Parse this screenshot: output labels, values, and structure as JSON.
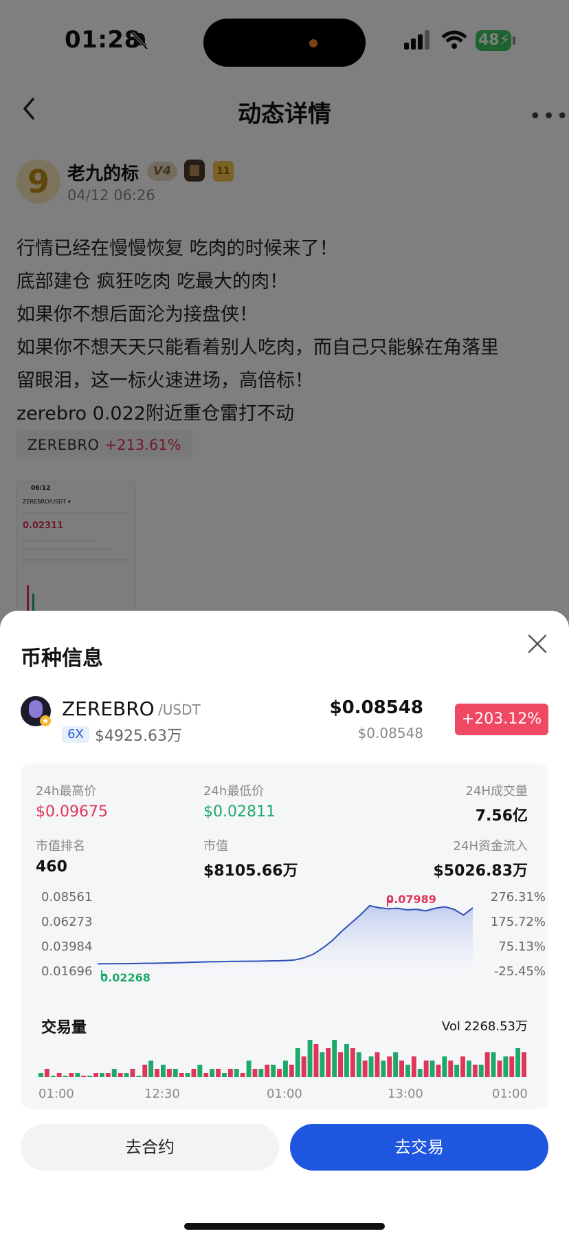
{
  "status_bar": {
    "time": "01:28",
    "battery": "48"
  },
  "nav": {
    "title": "动态详情"
  },
  "post": {
    "author": "老九的标",
    "author_avatar_text": "9",
    "badge_v": "V4",
    "badge_level": "11",
    "time": "04/12 06:26",
    "lines": [
      "行情已经在慢慢恢复 吃肉的时候来了！",
      "底部建仓 疯狂吃肉 吃最大的肉！",
      "如果你不想后面沦为接盘侠！",
      "如果你不想天天只能看着别人吃肉，而自己只能躲在角落里",
      "留眼泪，这一标火速进场，高倍标！",
      "zerebro 0.022附近重仓雷打不动"
    ],
    "tag": {
      "name": "ZEREBRO",
      "change": "+213.61%"
    },
    "thumbnail": {
      "time": "06/12",
      "pair": "ZEREBRO/USDT ▾",
      "price": "0.02311"
    }
  },
  "sheet": {
    "title": "币种信息",
    "coin": {
      "name": "ZEREBRO",
      "quote": "/USDT",
      "leverage": "6X",
      "market_cap": "$4925.63万",
      "price": "$0.08548",
      "price_sub": "$0.08548",
      "change": "+203.12%"
    },
    "stats": {
      "high_label": "24h最高价",
      "high_value": "$0.09675",
      "low_label": "24h最低价",
      "low_value": "$0.02811",
      "volume_label": "24H成交量",
      "volume_value": "7.56亿",
      "rank_label": "市值排名",
      "rank_value": "460",
      "mcap_label": "市值",
      "mcap_value": "$8105.66万",
      "inflow_label": "24H资金流入",
      "inflow_value": "$5026.83万"
    },
    "volume": {
      "title": "交易量",
      "total": "Vol 2268.53万"
    },
    "buttons": {
      "contract": "去合约",
      "trade": "去交易"
    }
  },
  "colors": {
    "up": "#e0355a",
    "down": "#1ea96a",
    "accent": "#1f56e0",
    "line": "#2b4fb8"
  },
  "chart_data": {
    "type": "line",
    "y_ticks_left": [
      "0.08561",
      "0.06273",
      "0.03984",
      "0.01696"
    ],
    "y_ticks_right": [
      "276.31%",
      "175.72%",
      "75.13%",
      "-25.45%"
    ],
    "x_ticks": [
      "01:00",
      "12:30",
      "01:00",
      "13:00",
      "01:00"
    ],
    "ylim": [
      0.01696,
      0.08561
    ],
    "high_marker": "0.07989",
    "low_marker": "0.02268",
    "price_series": [
      0.0227,
      0.0228,
      0.0229,
      0.0229,
      0.023,
      0.0232,
      0.0233,
      0.0234,
      0.0236,
      0.0239,
      0.0242,
      0.0245,
      0.0247,
      0.0248,
      0.025,
      0.0251,
      0.0252,
      0.0253,
      0.0254,
      0.0256,
      0.0259,
      0.0265,
      0.0285,
      0.032,
      0.038,
      0.045,
      0.054,
      0.062,
      0.07,
      0.079,
      0.077,
      0.076,
      0.0765,
      0.075,
      0.0755,
      0.074,
      0.0765,
      0.078,
      0.0755,
      0.07,
      0.077
    ],
    "volume_series": {
      "up": [
        1,
        0,
        0,
        1,
        0,
        1,
        2,
        1,
        0,
        4,
        3,
        2,
        1,
        3,
        2,
        1,
        2,
        4,
        2,
        3,
        4,
        7,
        9,
        6,
        9,
        8,
        6,
        5,
        4,
        6,
        3,
        2,
        4,
        5,
        3,
        4,
        3,
        6,
        5,
        7
      ],
      "down": [
        2,
        1,
        1,
        0,
        1,
        1,
        1,
        2,
        3,
        2,
        2,
        1,
        2,
        1,
        2,
        2,
        1,
        2,
        3,
        2,
        3,
        5,
        8,
        7,
        6,
        7,
        4,
        6,
        5,
        4,
        5,
        4,
        3,
        4,
        5,
        3,
        6,
        4,
        5,
        6
      ]
    }
  }
}
